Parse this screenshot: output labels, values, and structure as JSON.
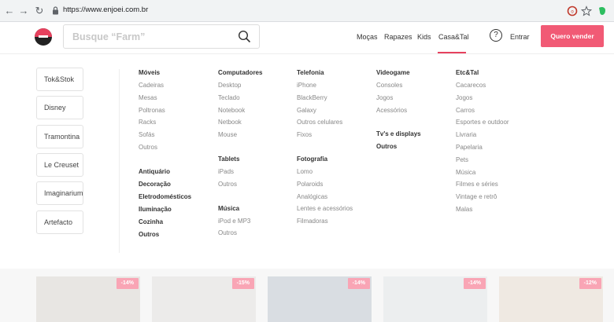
{
  "browser": {
    "url": "https://www.enjoei.com.br"
  },
  "header": {
    "search_placeholder": "Busque “Farm”",
    "nav": [
      "Moças",
      "Rapazes",
      "Kids",
      "Casa&Tal"
    ],
    "login": "Entrar",
    "sell_button": "Quero vender",
    "accent": "#f15a75"
  },
  "brands": [
    "Tok&Stok",
    "Disney",
    "Tramontina",
    "Le Creuset",
    "Imaginarium",
    "Artefacto"
  ],
  "menu": {
    "col1": {
      "head": "Móveis",
      "items": [
        "Cadeiras",
        "Mesas",
        "Poltronas",
        "Racks",
        "Sofás",
        "Outros"
      ],
      "extra_heads": [
        "Antiquário",
        "Decoração",
        "Eletrodomésticos",
        "Iluminação",
        "Cozinha",
        "Outros"
      ]
    },
    "col2": {
      "head": "Computadores",
      "items": [
        "Desktop",
        "Teclado",
        "Notebook",
        "Netbook",
        "Mouse"
      ],
      "head2": "Tablets",
      "items2": [
        "iPads",
        "Outros"
      ],
      "head3": "Música",
      "items3": [
        "iPod e MP3",
        "Outros"
      ]
    },
    "col3": {
      "head": "Telefonia",
      "items": [
        "iPhone",
        "BlackBerry",
        "Galaxy",
        "Outros celulares",
        "Fixos"
      ],
      "head2": "Fotografia",
      "items2": [
        "Lomo",
        "Polaroids",
        "Analógicas",
        "Lentes e acessórios",
        "Filmadoras"
      ]
    },
    "col4": {
      "head": "Videogame",
      "items": [
        "Consoles",
        "Jogos",
        "Acessórios"
      ],
      "head2": "Tv's e displays",
      "head3": "Outros"
    },
    "col5": {
      "head": "Etc&Tal",
      "items": [
        "Cacarecos",
        "Jogos",
        "Carros",
        "Esportes e outdoor",
        "Livraria",
        "Papelaria",
        "Pets",
        "Música",
        "Filmes e séries",
        "Vintage e retrô",
        "Malas"
      ]
    }
  },
  "products": [
    {
      "discount": "-14%"
    },
    {
      "discount": "-15%"
    },
    {
      "discount": "-14%"
    },
    {
      "discount": "-14%"
    },
    {
      "discount": "-12%"
    }
  ]
}
